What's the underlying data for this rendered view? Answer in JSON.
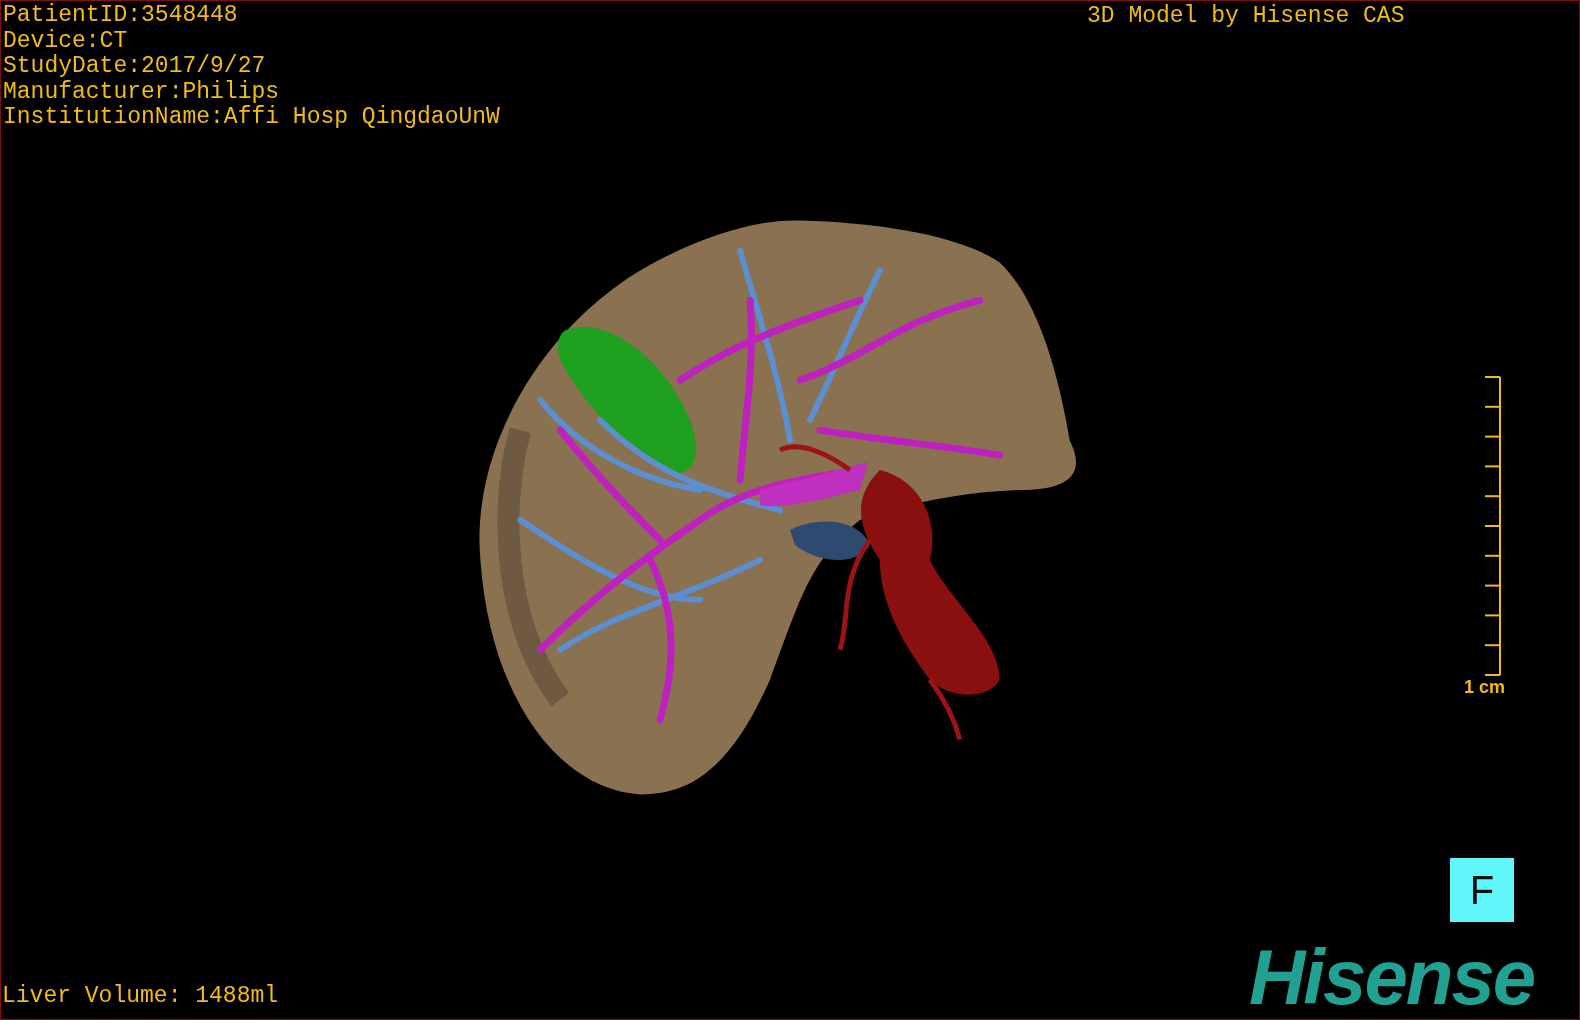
{
  "patient_info": [
    "PatientID:3548448",
    "Device:CT",
    "StudyDate:2017/9/27",
    "Manufacturer:Philips",
    "InstitutionName:Affi Hosp QingdaoUnW"
  ],
  "title": "3D Model by Hisense CAS",
  "scale_bar": {
    "label": "1 cm"
  },
  "orientation_cube": {
    "label": "F"
  },
  "logo": "Hisense",
  "liver_volume": "Liver Volume: 1488ml"
}
